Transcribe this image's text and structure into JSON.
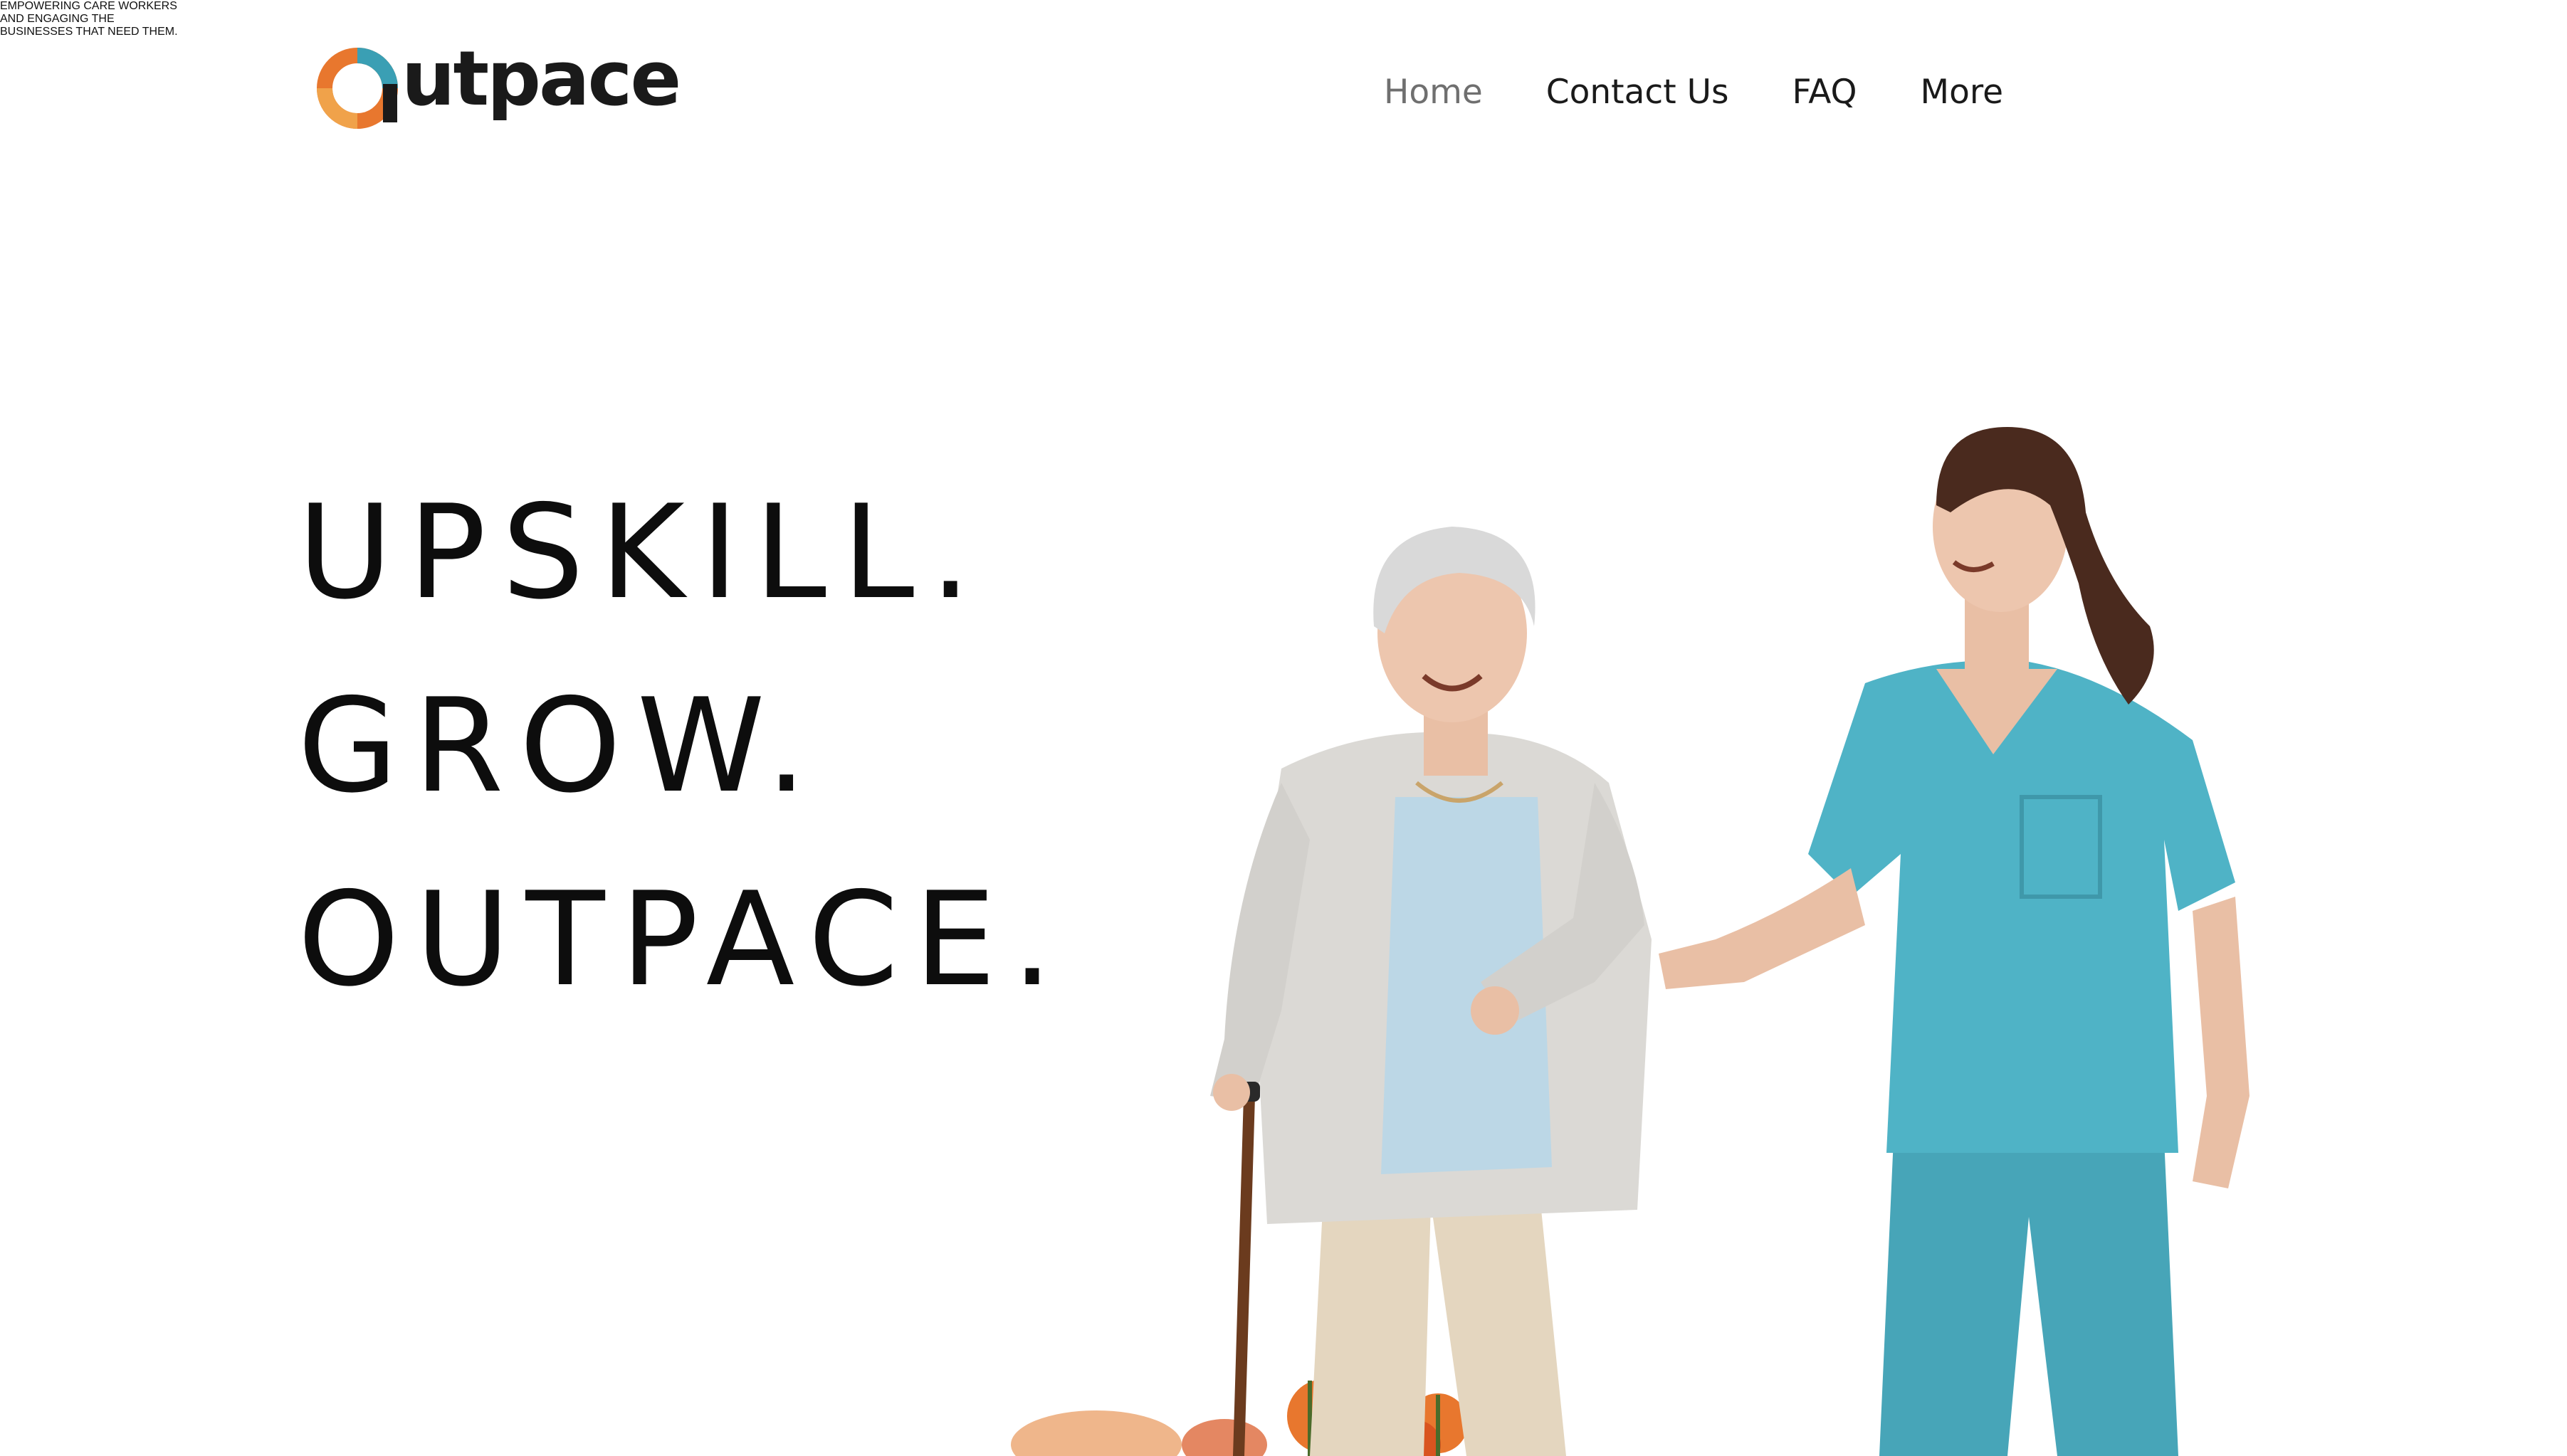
{
  "header": {
    "logo_text": "utpace",
    "nav": [
      {
        "label": "Home",
        "active": true
      },
      {
        "label": "Contact Us",
        "active": false
      },
      {
        "label": "FAQ",
        "active": false
      },
      {
        "label": "More",
        "active": false
      }
    ]
  },
  "hero": {
    "headline": [
      "UPSKILL.",
      "GROW.",
      "OUTPACE."
    ],
    "subheading": [
      "EMPOWERING CARE WORKERS",
      "AND ENGAGING THE",
      "BUSINESSES THAT NEED THEM."
    ],
    "image_alt": "care-worker-helping-elderly-woman"
  },
  "colors": {
    "logo_orange": "#E8772E",
    "logo_teal": "#3A9FB4",
    "scrubs_teal": "#4FB3C6",
    "nav_active": "#6F6F6F",
    "text_dark": "#111111"
  }
}
